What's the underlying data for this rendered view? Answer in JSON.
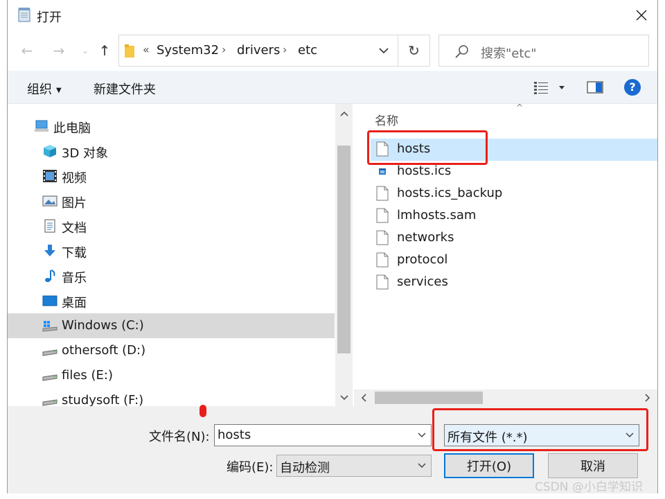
{
  "window": {
    "title": "打开"
  },
  "address": {
    "overflow": "«",
    "crumbs": [
      "System32",
      "drivers",
      "etc"
    ]
  },
  "search": {
    "placeholder": "搜索\"etc\""
  },
  "toolbar": {
    "organize": "组织",
    "new_folder": "新建文件夹",
    "help": "?"
  },
  "nav": {
    "items": [
      {
        "label": "此电脑",
        "icon": "computer-icon"
      },
      {
        "label": "3D 对象",
        "icon": "cube-3d-icon"
      },
      {
        "label": "视频",
        "icon": "video-icon"
      },
      {
        "label": "图片",
        "icon": "picture-icon"
      },
      {
        "label": "文档",
        "icon": "document-icon"
      },
      {
        "label": "下载",
        "icon": "download-icon"
      },
      {
        "label": "音乐",
        "icon": "music-icon"
      },
      {
        "label": "桌面",
        "icon": "desktop-icon"
      },
      {
        "label": "Windows (C:)",
        "icon": "windows-drive-icon"
      },
      {
        "label": "othersoft (D:)",
        "icon": "drive-icon"
      },
      {
        "label": "files (E:)",
        "icon": "drive-icon"
      },
      {
        "label": "studysoft (F:)",
        "icon": "drive-icon"
      }
    ]
  },
  "files": {
    "column_name": "名称",
    "items": [
      {
        "label": "hosts",
        "icon": "file-icon"
      },
      {
        "label": "hosts.ics",
        "icon": "ics-file-icon"
      },
      {
        "label": "hosts.ics_backup",
        "icon": "file-icon"
      },
      {
        "label": "lmhosts.sam",
        "icon": "file-icon"
      },
      {
        "label": "networks",
        "icon": "file-icon"
      },
      {
        "label": "protocol",
        "icon": "file-icon"
      },
      {
        "label": "services",
        "icon": "file-icon"
      }
    ]
  },
  "bottom": {
    "filename_label": "文件名(N):",
    "filename_value": "hosts",
    "filter_value": "所有文件  (*.*)",
    "encoding_label": "编码(E):",
    "encoding_value": "自动检测",
    "open_button": "打开(O)",
    "cancel_button": "取消"
  },
  "watermark": "CSDN @小白学知识",
  "colors": {
    "highlight": "#e8201a",
    "selection": "#cce8ff",
    "accent": "#0078d7"
  }
}
